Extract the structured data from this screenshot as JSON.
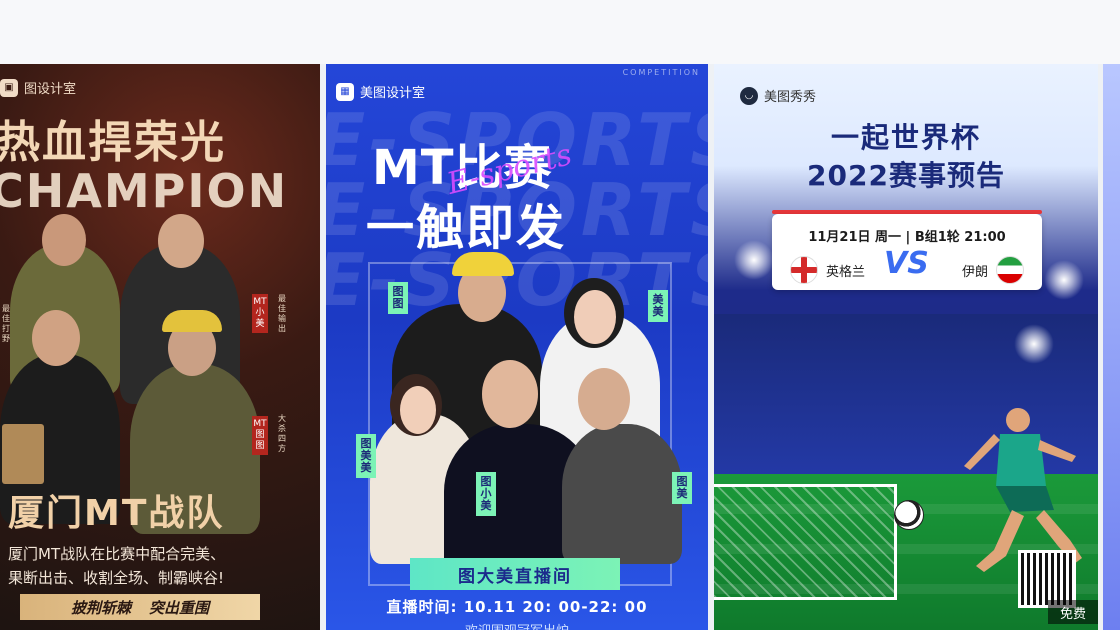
{
  "cards": [
    {
      "brand": "图设计室",
      "title": "热血捍荣光",
      "subtitle": "CHAMPION",
      "team": "厦门MT战队",
      "description_lines": [
        "厦门MT战队在比赛中配合完美、",
        "果断出击、收割全场、制霸峡谷!"
      ],
      "tags": [
        "披荆斩棘",
        "突出重围"
      ],
      "side_labels": [
        "MT小美",
        "MT图图",
        "MT图小美"
      ],
      "colors": {
        "accent": "#f3d7b6",
        "bg": "#1d1411"
      }
    },
    {
      "brand": "美图设计室",
      "corner_text": "COMPETITION",
      "bg_text": [
        "E-SPORTS",
        "E-SPORTS",
        "E-SPORTS"
      ],
      "title_line1": "MT比赛",
      "title_line2": "一触即发",
      "script": "E-sports",
      "names": [
        "图图",
        "美美",
        "图美美",
        "图小美",
        "图美"
      ],
      "live_label": "图大美直播间",
      "time": "直播时间: 10.11 20: 00-22: 00",
      "welcome": "欢迎围观冠军出炉",
      "colors": {
        "accent": "#7cf3b6",
        "bg": "#2446d8"
      }
    },
    {
      "brand": "美图秀秀",
      "title_line1": "一起世界杯",
      "title_line2": "2022赛事预告",
      "match_date": "11月21日 周一 | B组1轮 21:00",
      "team_left": "英格兰",
      "team_right": "伊朗",
      "vs": "VS",
      "free_badge": "免费",
      "colors": {
        "accent": "#1a2a7a",
        "vs": "#3a6cf0"
      }
    }
  ]
}
